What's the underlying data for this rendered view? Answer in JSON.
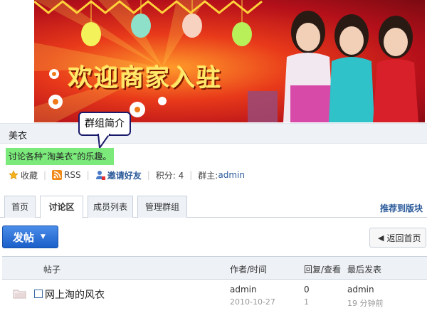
{
  "banner": {
    "headline": "欢迎商家入驻"
  },
  "group": {
    "name": "美衣",
    "callout": "群组简介",
    "description": "讨论各种“淘美衣”的乐趣。"
  },
  "meta": {
    "favorite": "收藏",
    "rss": "RSS",
    "invite": "邀请好友",
    "points_label": "积分: 4",
    "owner_label": "群主: ",
    "owner_name": "admin"
  },
  "tabs": [
    {
      "label": "首页"
    },
    {
      "label": "讨论区"
    },
    {
      "label": "成员列表"
    },
    {
      "label": "管理群组"
    }
  ],
  "recommend": "推荐到版块",
  "actions": {
    "post": "发帖",
    "back": "返回首页"
  },
  "table": {
    "headers": {
      "topic": "帖子",
      "author": "作者/时间",
      "stats": "回复/查看",
      "last": "最后发表"
    },
    "rows": [
      {
        "title": "网上淘的风衣",
        "author": "admin",
        "date": "2010-10-27",
        "replies": "0",
        "views": "1",
        "last_user": "admin",
        "last_time": "19 分钟前"
      }
    ]
  },
  "colors": {
    "accent": "#2a5a9a",
    "button": "#1b5fc9",
    "highlight": "#7bea7b"
  }
}
